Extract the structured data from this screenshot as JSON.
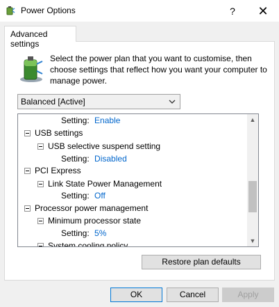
{
  "window": {
    "title": "Power Options",
    "help_label": "?",
    "close_label": "✕"
  },
  "tab": {
    "label": "Advanced settings"
  },
  "description": "Select the power plan that you want to customise, then choose settings that reflect how you want your computer to manage power.",
  "plan_select": {
    "value": "Balanced [Active]"
  },
  "tree": {
    "setting_enable": {
      "label": "Setting:",
      "value": "Enable"
    },
    "usb_settings": "USB settings",
    "usb_suspend": "USB selective suspend setting",
    "usb_setting": {
      "label": "Setting:",
      "value": "Disabled"
    },
    "pci_express": "PCI Express",
    "link_state": "Link State Power Management",
    "link_setting": {
      "label": "Setting:",
      "value": "Off"
    },
    "processor": "Processor power management",
    "min_state": "Minimum processor state",
    "min_setting": {
      "label": "Setting:",
      "value": "5%"
    },
    "cooling": "System cooling policy"
  },
  "buttons": {
    "restore": "Restore plan defaults",
    "ok": "OK",
    "cancel": "Cancel",
    "apply": "Apply"
  }
}
